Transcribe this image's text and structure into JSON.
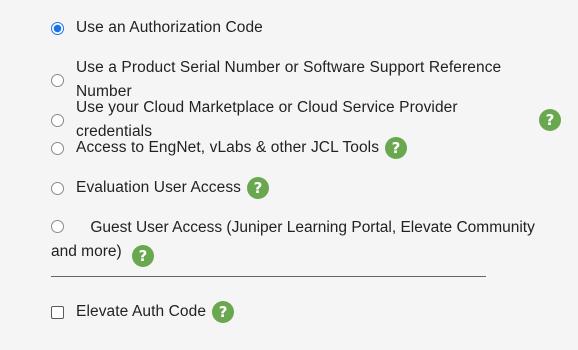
{
  "options": [
    {
      "label": "Use an Authorization Code",
      "selected": true,
      "has_help": false
    },
    {
      "label": "Use a Product Serial Number or Software Support Reference Number",
      "selected": false,
      "has_help": false
    },
    {
      "label": "Use your Cloud Marketplace or Cloud Service Provider credentials",
      "selected": false,
      "has_help": true
    },
    {
      "label": "Access to EngNet, vLabs & other JCL Tools",
      "selected": false,
      "has_help": true
    },
    {
      "label": "Evaluation User Access",
      "selected": false,
      "has_help": true
    },
    {
      "label": "Guest User Access (Juniper Learning Portal, Elevate Community and more)",
      "selected": false,
      "has_help": true
    }
  ],
  "checkbox": {
    "label": "Elevate Auth Code",
    "checked": false,
    "has_help": true
  },
  "help_glyph": "?",
  "colors": {
    "radio_selected": "#1a73e8",
    "help_badge": "#6aa84f",
    "text": "#222222"
  }
}
